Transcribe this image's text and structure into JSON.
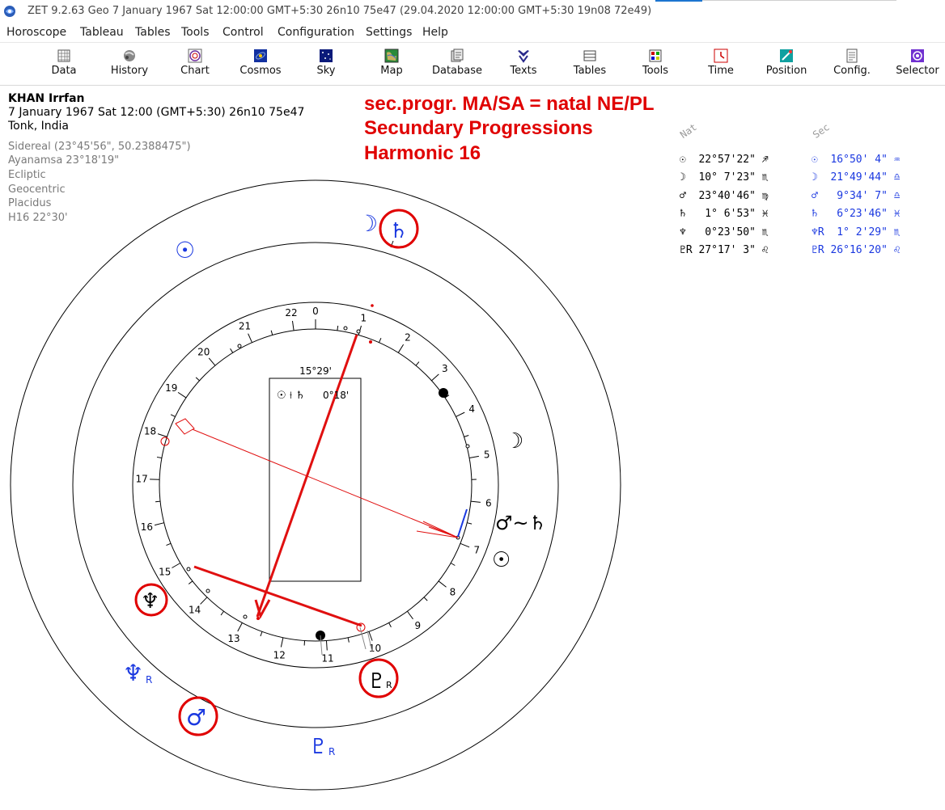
{
  "window": {
    "title": "ZET 9.2.63 Geo    7 January 1967  Sat  12:00:00 GMT+5:30 26n10  75e47  (29.04.2020  12:00:00 GMT+5:30 19n08 72e49)"
  },
  "menu": [
    "Horoscope",
    "Tableau",
    "Tables",
    "Tools",
    "Control",
    "Configuration",
    "Settings",
    "Help"
  ],
  "toolbar": [
    {
      "label": "Data",
      "icon": "data-grid-icon"
    },
    {
      "label": "History",
      "icon": "history-globe-icon"
    },
    {
      "label": "Chart",
      "icon": "chart-wheel-icon"
    },
    {
      "label": "Cosmos",
      "icon": "cosmos-icon"
    },
    {
      "label": "Sky",
      "icon": "sky-icon"
    },
    {
      "label": "Map",
      "icon": "map-icon"
    },
    {
      "label": "Database",
      "icon": "database-icon"
    },
    {
      "label": "Texts",
      "icon": "texts-icon"
    },
    {
      "label": "Tables",
      "icon": "tables-icon"
    },
    {
      "label": "Tools",
      "icon": "tools-icon"
    },
    {
      "label": "Time",
      "icon": "time-icon"
    },
    {
      "label": "Position",
      "icon": "position-icon"
    },
    {
      "label": "Config.",
      "icon": "config-icon"
    },
    {
      "label": "Selector",
      "icon": "selector-icon"
    }
  ],
  "person": {
    "name": "KHAN Irrfan",
    "datetime": "7 January 1967  Sat  12:00 (GMT+5:30) 26n10  75e47",
    "place": "Tonk, India",
    "details": [
      "Sidereal (23°45'56\", 50.2388475\")",
      "Ayanamsa 23°18'19\"",
      "Ecliptic",
      "Geocentric",
      "Placidus",
      "H16  22°30'"
    ]
  },
  "annotation": {
    "line1": "sec.progr. MA/SA = natal NE/PL",
    "line2": "Secundary Progressions",
    "line3": "Harmonic 16"
  },
  "positions": {
    "nat_header": "Nat",
    "sec_header": "Sec",
    "nat": [
      {
        "glyph": "☉",
        "text": "22°57'22\" ♐"
      },
      {
        "glyph": "☽",
        "text": "10° 7'23\" ♏"
      },
      {
        "glyph": "♂",
        "text": "23°40'46\" ♍"
      },
      {
        "glyph": "♄",
        "text": " 1° 6'53\" ♓"
      },
      {
        "glyph": "♆",
        "text": " 0°23'50\" ♏"
      },
      {
        "glyph": "♇R",
        "text": "27°17' 3\" ♌"
      }
    ],
    "sec": [
      {
        "glyph": "☉",
        "text": "16°50' 4\" ♒"
      },
      {
        "glyph": "☽",
        "text": "21°49'44\" ♎"
      },
      {
        "glyph": "♂",
        "text": " 9°34' 7\" ♎"
      },
      {
        "glyph": "♄",
        "text": " 6°23'46\" ♓"
      },
      {
        "glyph": "♆R",
        "text": " 1° 2'29\" ♏"
      },
      {
        "glyph": "♇R",
        "text": "26°16'20\" ♌"
      }
    ]
  },
  "chart": {
    "center_box_top": "15°29'",
    "center_box_label": "☉ ⟊ ♄",
    "center_box_value": "0°18'",
    "dial_numbers": [
      "0",
      "1",
      "2",
      "3",
      "4",
      "5",
      "6",
      "7",
      "8",
      "9",
      "10",
      "11",
      "12",
      "13",
      "14",
      "15",
      "16",
      "17",
      "18",
      "19",
      "20",
      "21",
      "22"
    ],
    "planet_labels": {
      "moon_sec": "☽",
      "saturn_sec": "♄",
      "sun_sec": "☉",
      "moon_nat": "☽",
      "mars_saturn_nat": "♂~♄",
      "sun_nat": "☉",
      "neptune_nat": "♆",
      "pluto_nat": "♇",
      "pluto_r": "R",
      "neptune_sec": "♆",
      "neptune_sec_r": "R",
      "mars_sec": "♂",
      "pluto_sec": "♇",
      "pluto_sec_r": "R"
    },
    "colors": {
      "annotation_red": "#e00000",
      "sec_blue": "#1a38e0",
      "chart_red": "#e01010"
    }
  }
}
